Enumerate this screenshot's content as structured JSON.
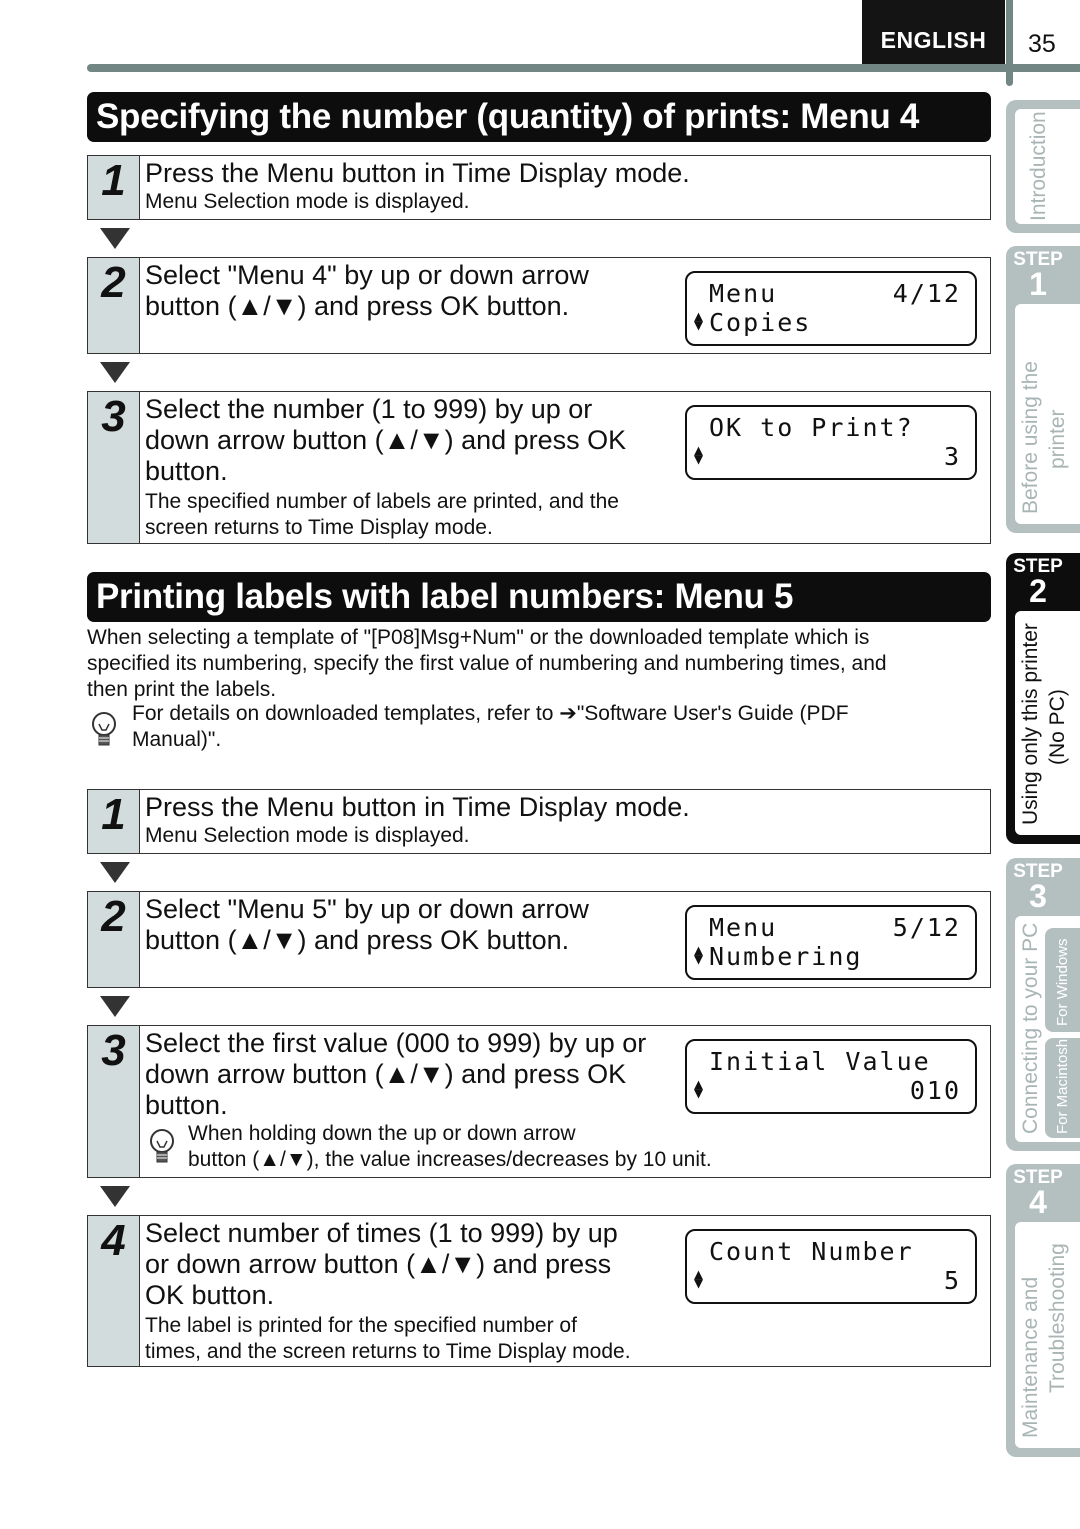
{
  "header": {
    "language": "ENGLISH",
    "page_number": "35"
  },
  "sidebar": {
    "intro": "Introduction",
    "step_label": "STEP",
    "steps": [
      {
        "num": "1",
        "lines": [
          "Before using the",
          "printer"
        ]
      },
      {
        "num": "2",
        "lines": [
          "Using only this printer",
          "(No PC)"
        ]
      },
      {
        "num": "3",
        "lines": [
          "Connecting to your PC"
        ],
        "subtabs": [
          "For Windows",
          "For Macintosh"
        ]
      },
      {
        "num": "4",
        "lines": [
          "Maintenance and",
          "Troubleshooting"
        ]
      }
    ]
  },
  "section1": {
    "title": "Specifying the number (quantity) of prints: Menu 4",
    "steps": [
      {
        "num": "1",
        "main": [
          "Press the Menu button in Time Display mode."
        ],
        "sub": [
          "Menu Selection mode is displayed."
        ]
      },
      {
        "num": "2",
        "main": [
          "Select \"Menu 4\" by up or down arrow",
          "button (▲/▼) and press OK button."
        ],
        "lcd": {
          "line1": "Menu",
          "line1_right": "4/12",
          "line2": "Copies",
          "line2_right": ""
        }
      },
      {
        "num": "3",
        "main": [
          "Select the number (1 to 999) by up or",
          "down arrow button (▲/▼) and press OK",
          "button."
        ],
        "sub": [
          "The specified number of labels are printed, and the",
          "screen returns to Time Display mode."
        ],
        "lcd": {
          "line1": "OK to Print?",
          "line1_right": "",
          "line2": "",
          "line2_right": "3"
        }
      }
    ]
  },
  "section2": {
    "title": "Printing labels with label numbers: Menu 5",
    "intro": [
      "When selecting a template of \"[P08]Msg+Num\" or the downloaded template which is",
      "specified its numbering, specify the first value of numbering and numbering times, and",
      "then print the labels."
    ],
    "tip": [
      "For details on downloaded templates, refer to ➔\"Software User's Guide (PDF",
      "Manual)\"."
    ],
    "steps": [
      {
        "num": "1",
        "main": [
          "Press the Menu button in Time Display mode."
        ],
        "sub": [
          "Menu Selection mode is displayed."
        ]
      },
      {
        "num": "2",
        "main": [
          "Select \"Menu 5\" by up or down arrow",
          "button (▲/▼) and press OK button."
        ],
        "lcd": {
          "line1": "Menu",
          "line1_right": "5/12",
          "line2": "Numbering",
          "line2_right": ""
        }
      },
      {
        "num": "3",
        "main": [
          "Select the first value (000 to 999) by up or",
          "down arrow button (▲/▼) and press OK",
          "button."
        ],
        "tip": [
          "When holding down the up or down arrow",
          "button (▲/▼), the value increases/decreases by 10 unit."
        ],
        "lcd": {
          "line1": "Initial Value",
          "line1_right": "",
          "line2": "",
          "line2_right": "010"
        }
      },
      {
        "num": "4",
        "main": [
          "Select number of times (1 to 999) by up",
          "or down arrow button (▲/▼) and press",
          "OK button."
        ],
        "sub": [
          "The label is printed for the specified number of",
          "times, and the screen returns to Time Display mode."
        ],
        "lcd": {
          "line1": "Count Number",
          "line1_right": "",
          "line2": "",
          "line2_right": "5"
        }
      }
    ]
  },
  "colors": {
    "accent_dark": "#0d0d0d",
    "rule_gray": "#728683",
    "tab_gray": "#b4c0c0",
    "step_number_bg": "#d3dcdc"
  }
}
